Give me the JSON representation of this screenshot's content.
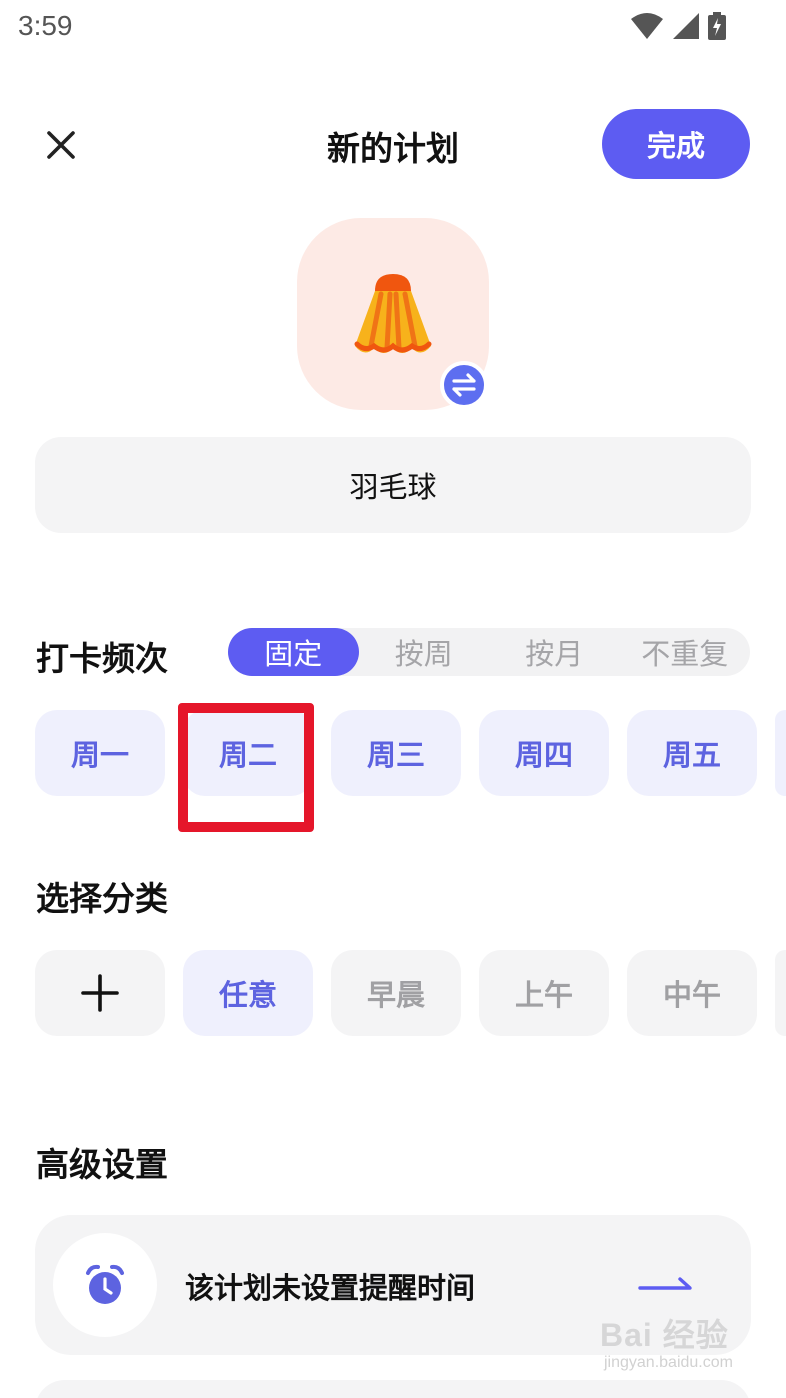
{
  "status_bar": {
    "time": "3:59",
    "icons": [
      "wifi-icon",
      "signal-icon",
      "battery-charging-icon"
    ]
  },
  "header": {
    "title": "新的计划",
    "close_icon": "close-icon",
    "done_label": "完成"
  },
  "plan_icon": {
    "icon": "badminton-shuttlecock-icon",
    "badge_icon": "swap-icon",
    "background": "#fdeae5"
  },
  "name_field": {
    "value": "羽毛球"
  },
  "frequency": {
    "title": "打卡频次",
    "modes": [
      "固定",
      "按周",
      "按月",
      "不重复"
    ],
    "selected_mode": "固定",
    "days": [
      "周一",
      "周二",
      "周三",
      "周四",
      "周五"
    ]
  },
  "category": {
    "title": "选择分类",
    "add_icon": "plus-icon",
    "items": [
      "任意",
      "早晨",
      "上午",
      "中午"
    ],
    "selected": "任意"
  },
  "advanced": {
    "title": "高级设置",
    "reminder_text": "该计划未设置提醒时间",
    "reminder_icon": "alarm-clock-icon",
    "arrow_icon": "arrow-right-icon"
  },
  "watermark": {
    "text": "Bai 经验",
    "sub": "jingyan.baidu.com"
  },
  "colors": {
    "accent": "#5d5cf2",
    "chip_bg": "#eff0fd",
    "highlight": "#e5162a"
  }
}
